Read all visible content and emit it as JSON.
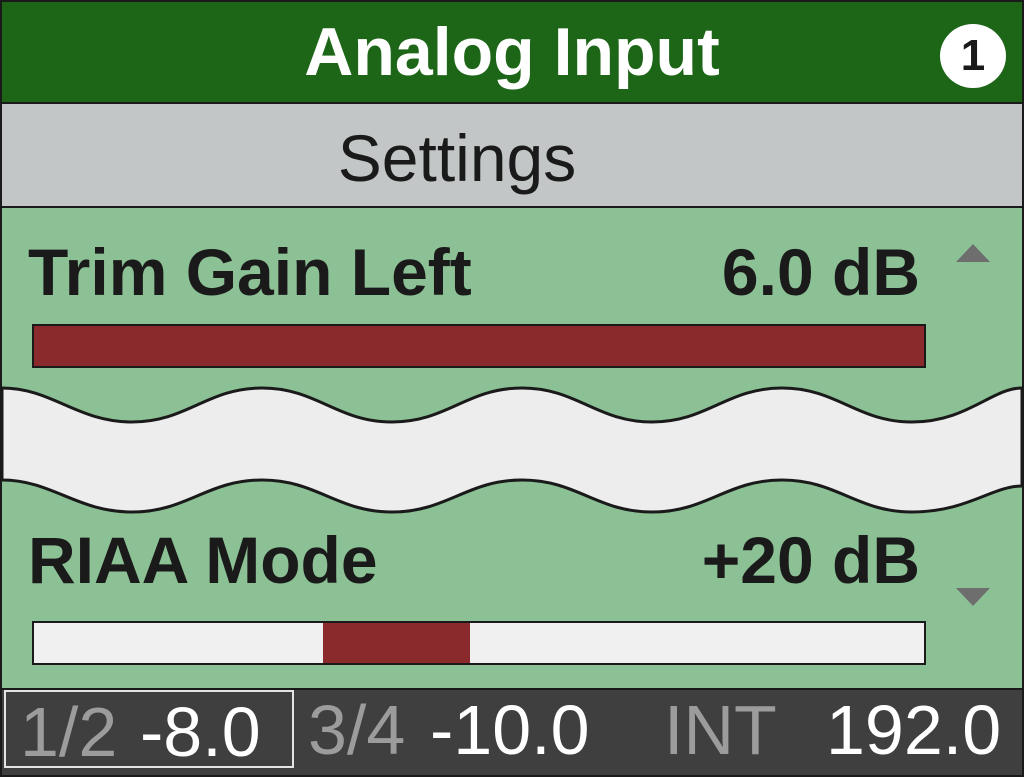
{
  "header": {
    "title": "Analog Input",
    "channel_badge": "1"
  },
  "subheader": {
    "title": "Settings"
  },
  "params": [
    {
      "label": "Trim Gain Left",
      "value": "6.0 dB",
      "bar": {
        "fill_start": 0.0,
        "fill_end": 1.0
      }
    },
    {
      "label": "RIAA Mode",
      "value": "+20 dB",
      "bar": {
        "fill_start": 0.325,
        "fill_end": 0.49
      }
    }
  ],
  "status_bar": [
    {
      "label": "1/2",
      "value": "-8.0",
      "selected": true
    },
    {
      "label": "3/4",
      "value": "-10.0",
      "selected": false
    },
    {
      "label": "INT",
      "value": "192.0",
      "selected": false
    }
  ],
  "colors": {
    "header_bg": "#1d6618",
    "subheader_bg": "#c2c6c6",
    "content_bg": "#8cc095",
    "bar_fill": "#8a2a2d",
    "bar_bg": "#f0f0f0",
    "status_bg": "#3f3f3f",
    "break_band": "#ededed"
  },
  "icons": {
    "scroll_up": "triangle-up",
    "scroll_down": "triangle-down"
  }
}
